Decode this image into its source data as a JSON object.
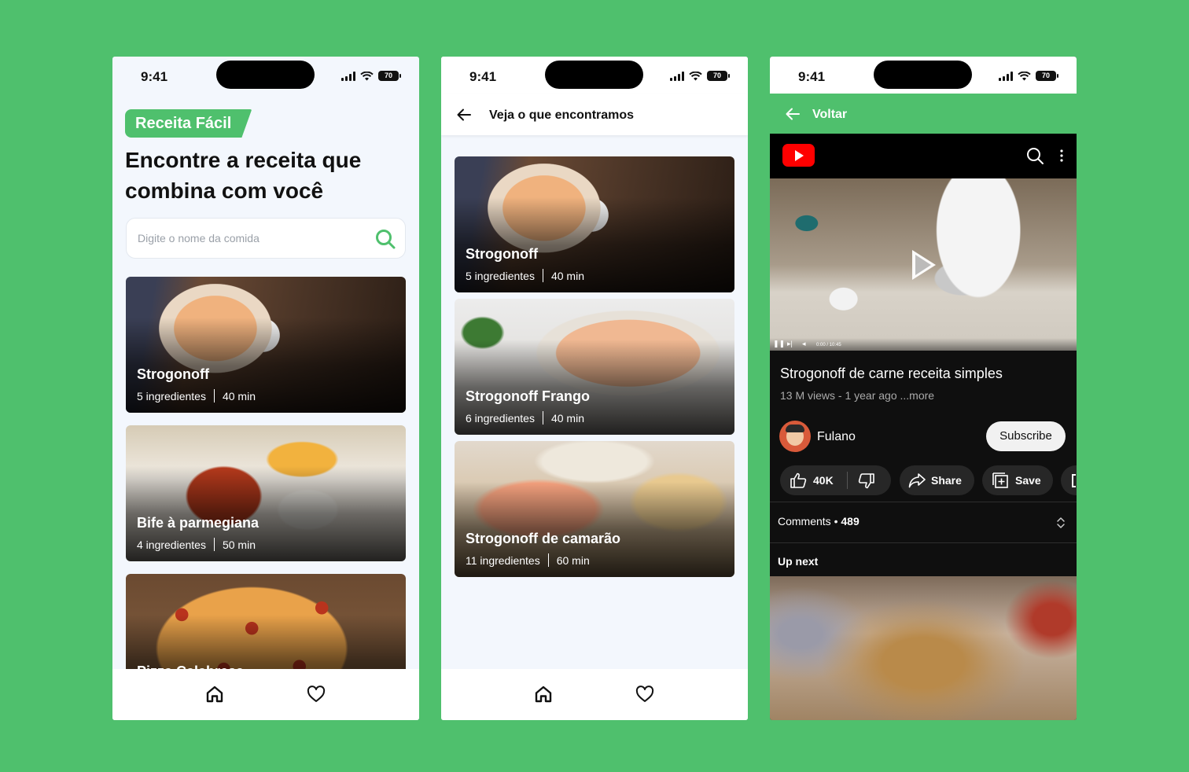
{
  "colors": {
    "background": "#4fc06d",
    "brand": "#4fc06d",
    "screen": "#f3f7fd",
    "youtube_red": "#ff0000",
    "dark": "#0f0f0f"
  },
  "status": {
    "time": "9:41",
    "battery": "70"
  },
  "home": {
    "badge": "Receita Fácil",
    "headline": "Encontre a receita que combina com você",
    "search": {
      "placeholder": "Digite o nome da comida",
      "icon": "search-icon"
    },
    "recipes": [
      {
        "title": "Strogonoff",
        "ingredients": "5 ingredientes",
        "time": "40 min"
      },
      {
        "title": "Bife à parmegiana",
        "ingredients": "4 ingredientes",
        "time": "50 min"
      },
      {
        "title": "Pizza Calabresa",
        "ingredients": "",
        "time": ""
      }
    ]
  },
  "results": {
    "title": "Veja o que encontramos",
    "recipes": [
      {
        "title": "Strogonoff",
        "ingredients": "5 ingredientes",
        "time": "40 min"
      },
      {
        "title": "Strogonoff Frango",
        "ingredients": "6 ingredientes",
        "time": "40 min"
      },
      {
        "title": "Strogonoff de camarão",
        "ingredients": "11 ingredientes",
        "time": "60 min"
      }
    ]
  },
  "tabbar": {
    "icons": [
      "home-icon",
      "heart-icon"
    ]
  },
  "video": {
    "back_label": "Voltar",
    "time_readout": "0:00 / 10:45",
    "title": "Strogonoff de carne receita simples",
    "meta": "13 M views - 1 year ago ...more",
    "channel": "Fulano",
    "subscribe": "Subscribe",
    "likes": "40K",
    "share": "Share",
    "save": "Save",
    "comments_label": "Comments •",
    "comments_count": "489",
    "up_next": "Up next"
  }
}
